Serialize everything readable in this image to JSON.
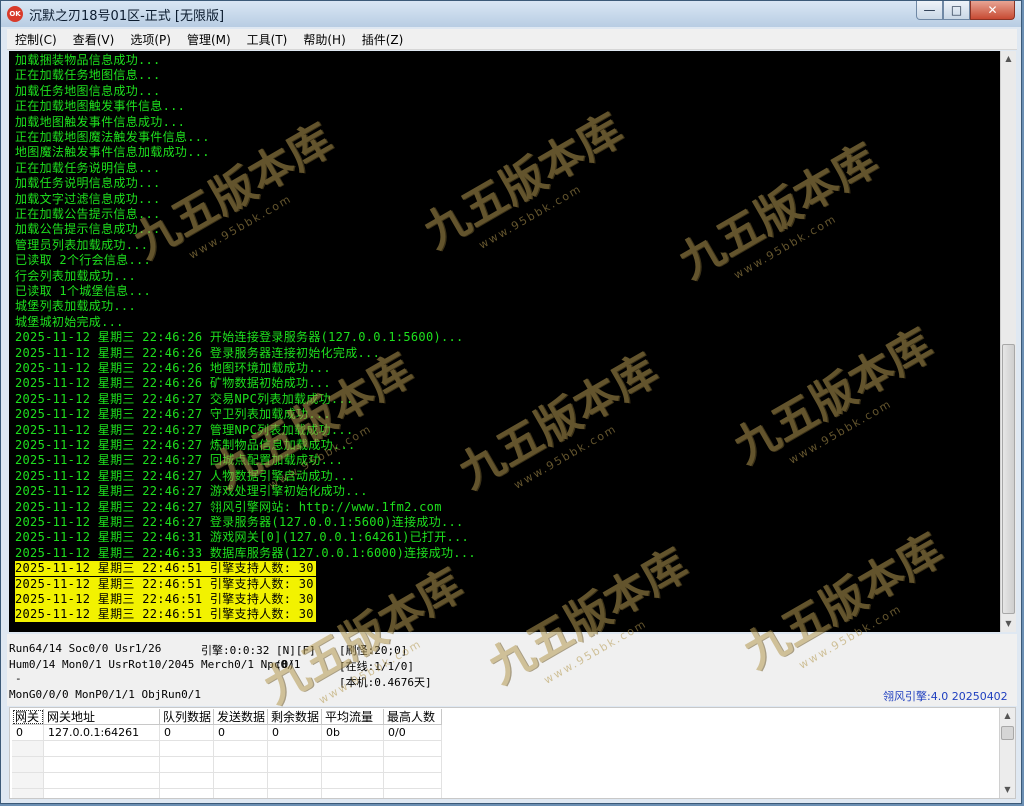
{
  "window": {
    "title": "沉默之刃18号01区-正式 [无限版]",
    "app_icon_text": "OK"
  },
  "window_buttons": {
    "minimize": "—",
    "maximize": "□",
    "close": "✕"
  },
  "menu": [
    "控制(C)",
    "查看(V)",
    "选项(P)",
    "管理(M)",
    "工具(T)",
    "帮助(H)",
    "插件(Z)"
  ],
  "log": [
    {
      "text": "加载捆装物品信息成功...",
      "hl": false
    },
    {
      "text": "正在加载任务地图信息...",
      "hl": false
    },
    {
      "text": "加载任务地图信息成功...",
      "hl": false
    },
    {
      "text": "正在加载地图触发事件信息...",
      "hl": false
    },
    {
      "text": "加载地图触发事件信息成功...",
      "hl": false
    },
    {
      "text": "正在加载地图魔法触发事件信息...",
      "hl": false
    },
    {
      "text": "地图魔法触发事件信息加载成功...",
      "hl": false
    },
    {
      "text": "正在加载任务说明信息...",
      "hl": false
    },
    {
      "text": "加载任务说明信息成功...",
      "hl": false
    },
    {
      "text": "加载文字过滤信息成功...",
      "hl": false
    },
    {
      "text": "正在加载公告提示信息...",
      "hl": false
    },
    {
      "text": "加载公告提示信息成功...",
      "hl": false
    },
    {
      "text": "管理员列表加载成功...",
      "hl": false
    },
    {
      "text": "已读取 2个行会信息...",
      "hl": false
    },
    {
      "text": "行会列表加载成功...",
      "hl": false
    },
    {
      "text": "已读取 1个城堡信息...",
      "hl": false
    },
    {
      "text": "城堡列表加载成功...",
      "hl": false
    },
    {
      "text": "城堡城初始完成...",
      "hl": false
    },
    {
      "text": "2025-11-12 星期三 22:46:26 开始连接登录服务器(127.0.0.1:5600)...",
      "hl": false
    },
    {
      "text": "2025-11-12 星期三 22:46:26 登录服务器连接初始化完成...",
      "hl": false
    },
    {
      "text": "2025-11-12 星期三 22:46:26 地图环境加载成功...",
      "hl": false
    },
    {
      "text": "2025-11-12 星期三 22:46:26 矿物数据初始成功...",
      "hl": false
    },
    {
      "text": "2025-11-12 星期三 22:46:27 交易NPC列表加载成功...",
      "hl": false
    },
    {
      "text": "2025-11-12 星期三 22:46:27 守卫列表加载成功...",
      "hl": false
    },
    {
      "text": "2025-11-12 星期三 22:46:27 管理NPC列表加载成功...",
      "hl": false
    },
    {
      "text": "2025-11-12 星期三 22:46:27 炼制物品信息加载成功...",
      "hl": false
    },
    {
      "text": "2025-11-12 星期三 22:46:27 回城点配置加载成功...",
      "hl": false
    },
    {
      "text": "2025-11-12 星期三 22:46:27 人物数据引擎启动成功...",
      "hl": false
    },
    {
      "text": "2025-11-12 星期三 22:46:27 游戏处理引擎初始化成功...",
      "hl": false
    },
    {
      "text": "2025-11-12 星期三 22:46:27 翎风引擎网站: http://www.1fm2.com",
      "hl": false
    },
    {
      "text": "2025-11-12 星期三 22:46:27 登录服务器(127.0.0.1:5600)连接成功...",
      "hl": false
    },
    {
      "text": "2025-11-12 星期三 22:46:31 游戏网关[0](127.0.0.1:64261)已打开...",
      "hl": false
    },
    {
      "text": "2025-11-12 星期三 22:46:33 数据库服务器(127.0.0.1:6000)连接成功...",
      "hl": false
    },
    {
      "text": "2025-11-12 星期三 22:46:51 引擎支持人数: 30",
      "hl": true
    },
    {
      "text": "2025-11-12 星期三 22:46:51 引擎支持人数: 30",
      "hl": true
    },
    {
      "text": "2025-11-12 星期三 22:46:51 引擎支持人数: 30",
      "hl": true
    },
    {
      "text": "2025-11-12 星期三 22:46:51 引擎支持人数: 30",
      "hl": true
    }
  ],
  "status": {
    "run": "Run64/14 Soc0/0 Usr1/26",
    "hum": "Hum0/14 Mon0/1 UsrRot10/2045 Merch0/1 Npc0/1",
    "dash": "-",
    "mon": "MonG0/0/0 MonP0/1/1 ObjRun0/1",
    "engine": "引擎:0:0:32 [N][F]",
    "zero": "(0)",
    "refresh": "[刷怪:20;0]",
    "online": "[在线:1/1/0]",
    "local": "[本机:0.4676天]",
    "version": "翎风引擎:4.0 20250402"
  },
  "gateway_table": {
    "headers": [
      "网关",
      "网关地址",
      "队列数据",
      "发送数据",
      "剩余数据",
      "平均流量",
      "最高人数"
    ],
    "rows": [
      [
        "0",
        "127.0.0.1:64261",
        "0",
        "0",
        "0",
        "0b",
        "0/0"
      ]
    ]
  },
  "watermark": {
    "main": "九五版本库",
    "sub": "www.95bbk.com"
  },
  "colors": {
    "console_bg": "#000000",
    "log_text": "#1ee01e",
    "highlight_bg": "#f2f200",
    "version_text": "#1f3fbf"
  }
}
